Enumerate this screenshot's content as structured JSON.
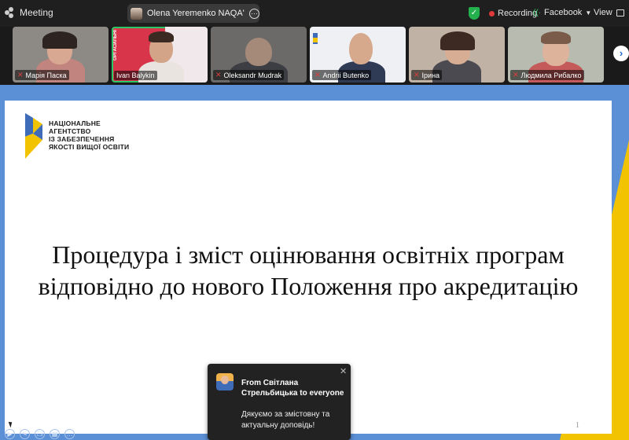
{
  "topbar": {
    "meeting_label": "Meeting",
    "share_label": "Olena Yeremenko NAQA's screen",
    "recording_label": "Recording",
    "stream_label": "Facebook",
    "view_label": "View"
  },
  "participants": [
    {
      "name": "Марія Паска",
      "active": false
    },
    {
      "name": "Ivan Balykin",
      "active": true
    },
    {
      "name": "Oleksandr Mudrak",
      "active": false
    },
    {
      "name": "Andrii Butenko",
      "active": false
    },
    {
      "name": "Ірина",
      "active": false
    },
    {
      "name": "Людмила Рибалко",
      "active": false
    }
  ],
  "tile_poster_text": "ОРГАСИЛЬНІ",
  "slide": {
    "logo_lines": [
      "НАЦІОНАЛЬНЕ",
      "АГЕНТСТВО",
      "ІЗ ЗАБЕЗПЕЧЕННЯ",
      "ЯКОСТІ ВИЩОЇ ОСВІТИ"
    ],
    "title_line1": "Процедура і зміст оцінювання освітніх програм",
    "title_line2": "відповідно до нового Положення про акредитацію",
    "page_number": "1"
  },
  "chat": {
    "from": "From Світлана Стрельбицька to everyone",
    "message": "Дякуємо за змістовну та актуальну доповідь!"
  },
  "colors": {
    "share_blue": "#5b8fd6",
    "share_yellow": "#f2c300",
    "active_speaker": "#2cc765",
    "recording": "#e23a3a"
  }
}
